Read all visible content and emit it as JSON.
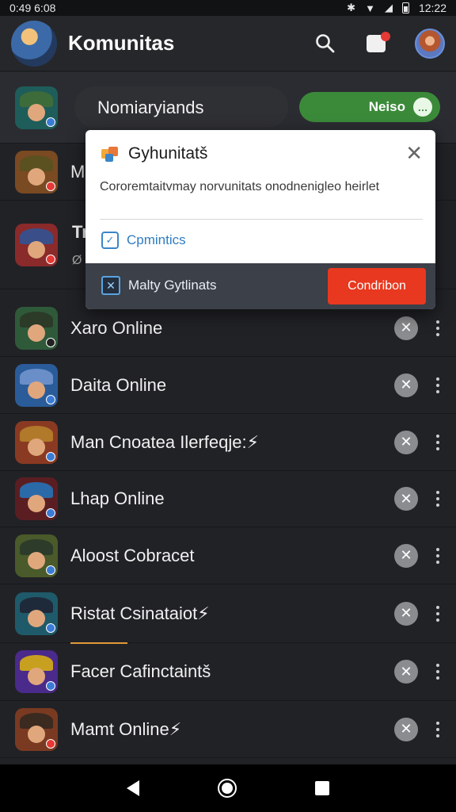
{
  "status_bar": {
    "time_left": "0:49 6:08",
    "time_right": "12:22"
  },
  "app_bar": {
    "title": "Komunitas"
  },
  "featured": {
    "label": "Nomiaryiands",
    "action_label": "Neiso"
  },
  "partial_rows": [
    {
      "label": "M"
    },
    {
      "label": "Tr",
      "sub": "Ø"
    }
  ],
  "dialog": {
    "title": "Gyhunitatš",
    "description": "Cororemtaitvmay norvunitats onodnenigleo heirlet",
    "link_label": "Cpmintics",
    "footer_label": "Malty Gytlinats",
    "confirm_label": "Condribon"
  },
  "rows": [
    {
      "label": "Xaro Online"
    },
    {
      "label": "Daita Online"
    },
    {
      "label": "Man Cnoatea Ilerfeqje:⚡"
    },
    {
      "label": "Lhap Online"
    },
    {
      "label": "Aloost Cobracet"
    },
    {
      "label": "Ristat Csinataiot⚡"
    },
    {
      "label": "Facer Cafinctaintš"
    },
    {
      "label": "Mamt Online⚡"
    }
  ],
  "colors": {
    "accent_green": "#3b8a3a",
    "confirm_red": "#e8381f",
    "link_blue": "#2f7cc0"
  },
  "icons": [
    "search-icon",
    "notification-icon",
    "avatar",
    "close-icon",
    "more-vert-icon",
    "chat-icon",
    "back-icon",
    "home-icon",
    "recents-icon"
  ]
}
